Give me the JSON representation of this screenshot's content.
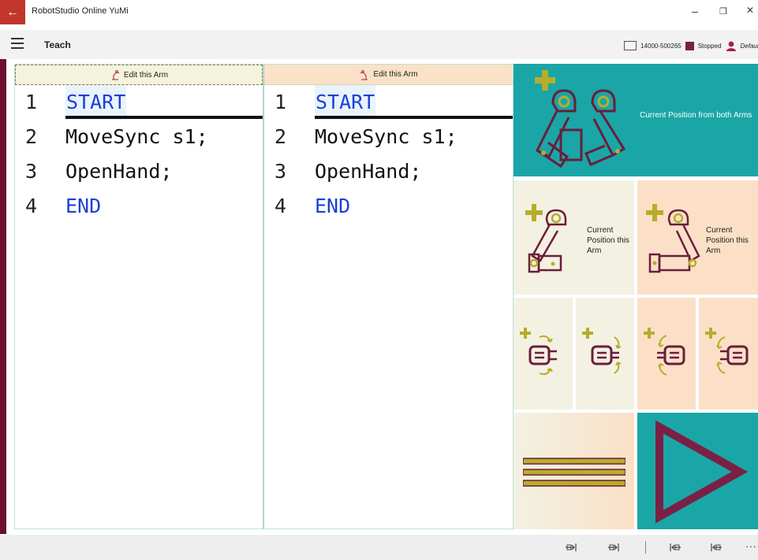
{
  "window": {
    "app_title": "RobotStudio Online YuMi",
    "back_glyph": "←",
    "minimize_glyph": "–",
    "restore_glyph": "❐",
    "close_glyph": "✕"
  },
  "appbar": {
    "page_title": "Teach",
    "controller_id": "14000-500265",
    "state": "Stopped",
    "user": "Default User",
    "accent_color": "#7b2045"
  },
  "editors": [
    {
      "header": "Edit this Arm",
      "lines": [
        {
          "num": "1",
          "text": "START"
        },
        {
          "num": "2",
          "text": "MoveSync s1;"
        },
        {
          "num": "3",
          "text": "OpenHand;"
        },
        {
          "num": "4",
          "text": "END"
        }
      ]
    },
    {
      "header": "Edit this Arm",
      "lines": [
        {
          "num": "1",
          "text": "START"
        },
        {
          "num": "2",
          "text": "MoveSync s1;"
        },
        {
          "num": "3",
          "text": "OpenHand;"
        },
        {
          "num": "4",
          "text": "END"
        }
      ]
    }
  ],
  "tiles": {
    "both_arms": "Current Position from both Arms",
    "this_arm_left": "Current Position this Arm",
    "this_arm_right": "Current Position this Arm"
  },
  "colors": {
    "teal": "#1aa6a6",
    "cream": "#f3f1e2",
    "peach": "#fbe0c7",
    "olive": "#b7ad2a",
    "plum": "#7b2045",
    "keyword": "#1c3fd6"
  },
  "bottom_bar": {
    "more": "···"
  }
}
